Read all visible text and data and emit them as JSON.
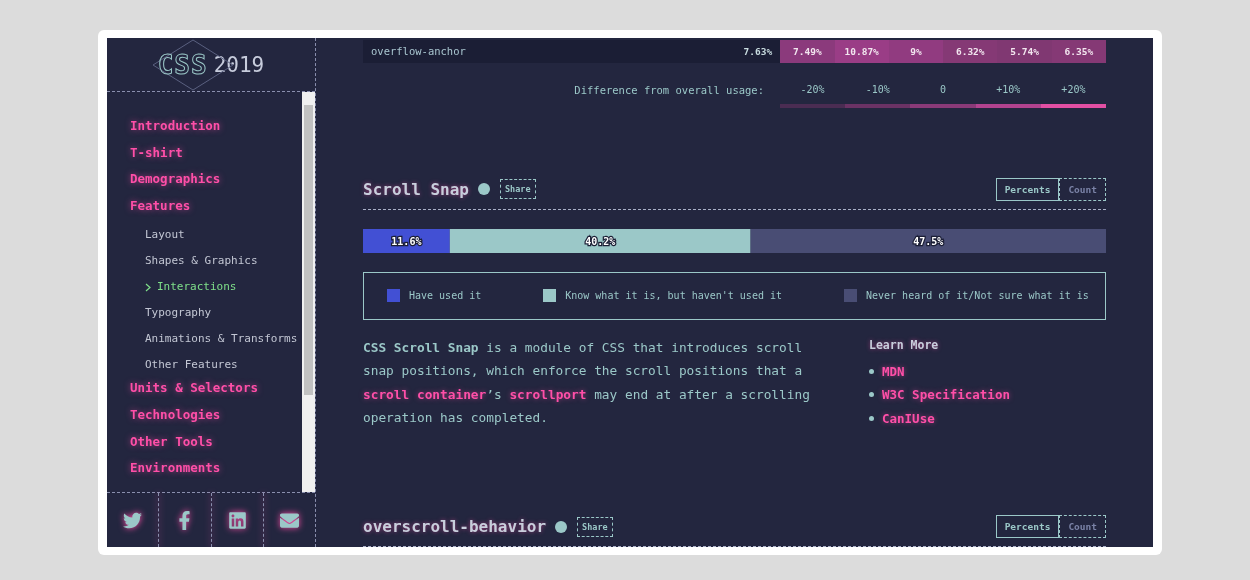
{
  "sidebar": {
    "logo": {
      "letters": "CSS",
      "year": "2019"
    },
    "nav": [
      {
        "label": "Introduction",
        "selected": false
      },
      {
        "label": "T-shirt",
        "selected": false
      },
      {
        "label": "Demographics",
        "selected": false
      },
      {
        "label": "Features",
        "selected": false,
        "children": [
          {
            "label": "Layout",
            "selected": false
          },
          {
            "label": "Shapes & Graphics",
            "selected": false
          },
          {
            "label": "Interactions",
            "selected": true
          },
          {
            "label": "Typography",
            "selected": false
          },
          {
            "label": "Animations & Transforms",
            "selected": false
          },
          {
            "label": "Other Features",
            "selected": false
          }
        ]
      },
      {
        "label": "Units & Selectors",
        "selected": false
      },
      {
        "label": "Technologies",
        "selected": false
      },
      {
        "label": "Other Tools",
        "selected": false
      },
      {
        "label": "Environments",
        "selected": false
      }
    ],
    "social": [
      {
        "kind": "twitter"
      },
      {
        "kind": "facebook"
      },
      {
        "kind": "linkedin"
      },
      {
        "kind": "email"
      }
    ]
  },
  "usage_row": {
    "name": "overflow-anchor",
    "overall": "7.63%",
    "cells": [
      {
        "value": "7.49%",
        "color": "#8b3a7c"
      },
      {
        "value": "10.87%",
        "color": "#9a3d86"
      },
      {
        "value": "9%",
        "color": "#913b80"
      },
      {
        "value": "6.32%",
        "color": "#853975"
      },
      {
        "value": "5.74%",
        "color": "#803872"
      },
      {
        "value": "6.35%",
        "color": "#853975"
      }
    ]
  },
  "difference_legend": {
    "label": "Difference from overall usage:",
    "steps": [
      {
        "label": "-20%",
        "color": "#4a2c52"
      },
      {
        "label": "-10%",
        "color": "#6a3264"
      },
      {
        "label": "0",
        "color": "#8a3a78"
      },
      {
        "label": "+10%",
        "color": "#b2438f"
      },
      {
        "label": "+20%",
        "color": "#e24fa3"
      }
    ]
  },
  "sections": [
    {
      "title": "Scroll Snap",
      "share": "Share",
      "toggle": [
        {
          "label": "Percents",
          "selected": true
        },
        {
          "label": "Count",
          "selected": false
        }
      ],
      "chart_data": {
        "type": "bar",
        "orientation": "horizontal",
        "stacked": true,
        "series": [
          {
            "name": "Have used it",
            "color": "#4250d4",
            "values": [
              11.6
            ],
            "value_labels": [
              "11.6%"
            ]
          },
          {
            "name": "Know what it is, but haven't used it",
            "color": "#9bc8c8",
            "values": [
              40.2
            ],
            "value_labels": [
              "40.2%"
            ]
          },
          {
            "name": "Never heard of it/Not sure what it is",
            "color": "#494d74",
            "values": [
              47.5
            ],
            "value_labels": [
              "47.5%"
            ]
          }
        ]
      },
      "description": [
        {
          "kind": "strong",
          "text": "CSS Scroll Snap"
        },
        {
          "kind": "text",
          "text": " is a module of CSS that introduces scroll snap positions, which enforce the scroll positions that a "
        },
        {
          "kind": "link",
          "text": "scroll container"
        },
        {
          "kind": "text",
          "text": "’s "
        },
        {
          "kind": "link",
          "text": "scrollport"
        },
        {
          "kind": "text",
          "text": " may end at after a scrolling operation has completed."
        }
      ],
      "learn_more": {
        "title": "Learn More",
        "links": [
          "MDN",
          "W3C Specification",
          "CanIUse"
        ]
      }
    },
    {
      "title": "overscroll-behavior",
      "share": "Share",
      "toggle": [
        {
          "label": "Percents",
          "selected": true
        },
        {
          "label": "Count",
          "selected": false
        }
      ]
    }
  ]
}
